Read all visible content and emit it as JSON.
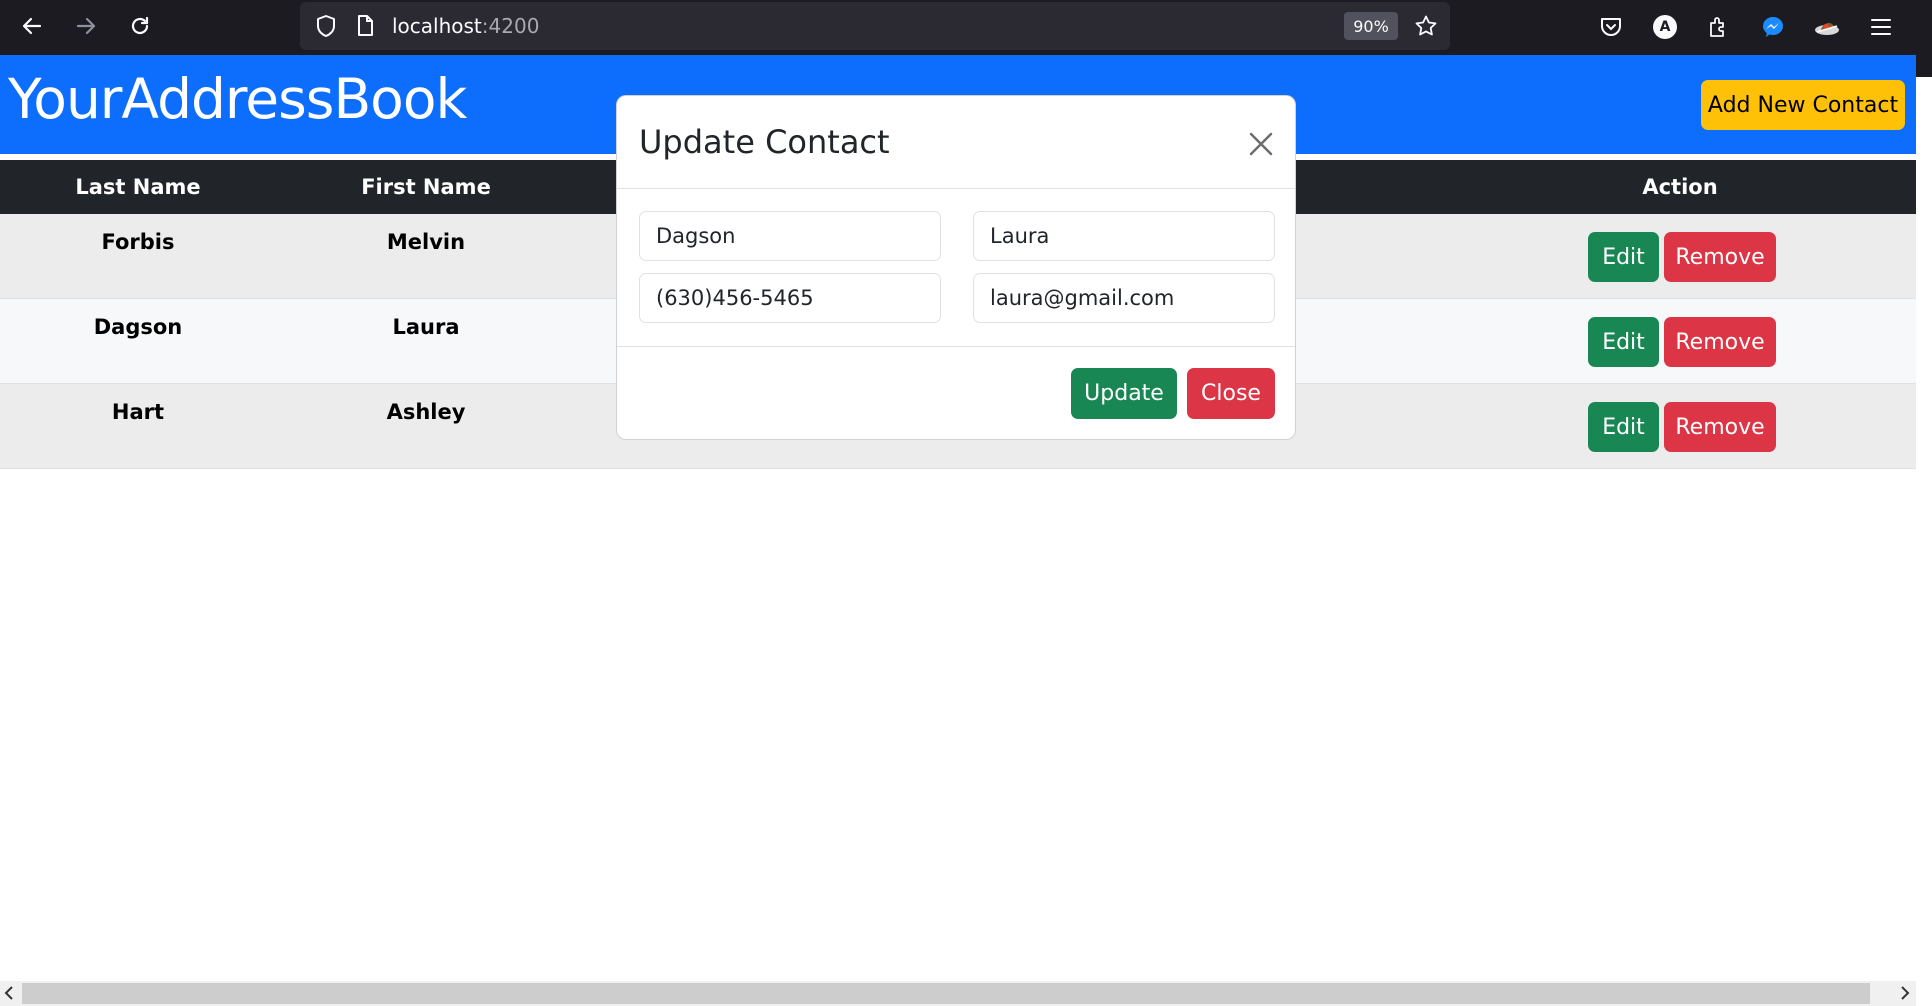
{
  "browser": {
    "url_host": "localhost",
    "url_port": ":4200",
    "zoom": "90%",
    "profile_initial": "A",
    "icons": [
      "back-arrow-icon",
      "forward-arrow-icon",
      "reload-icon",
      "shield-icon",
      "page-icon",
      "star-icon",
      "pocket-icon",
      "account-icon",
      "extensions-icon",
      "messenger-icon",
      "extension-hat-icon",
      "menu-icon"
    ]
  },
  "header": {
    "brand": "YourAddressBook",
    "add_button": "Add New Contact"
  },
  "table": {
    "columns": [
      "Last Name",
      "First Name",
      "Action"
    ],
    "rows": [
      {
        "last": "Forbis",
        "first": "Melvin"
      },
      {
        "last": "Dagson",
        "first": "Laura"
      },
      {
        "last": "Hart",
        "first": "Ashley"
      }
    ],
    "edit_label": "Edit",
    "remove_label": "Remove"
  },
  "modal": {
    "title": "Update Contact",
    "last_name": "Dagson",
    "first_name": "Laura",
    "phone": "(630)456-5465",
    "email": "laura@gmail.com",
    "update_label": "Update",
    "close_label": "Close"
  },
  "colors": {
    "primary": "#0d6efd",
    "warning": "#ffc107",
    "success": "#198754",
    "danger": "#dc3545",
    "dark": "#212529",
    "stripe": "#f2f2f2"
  }
}
